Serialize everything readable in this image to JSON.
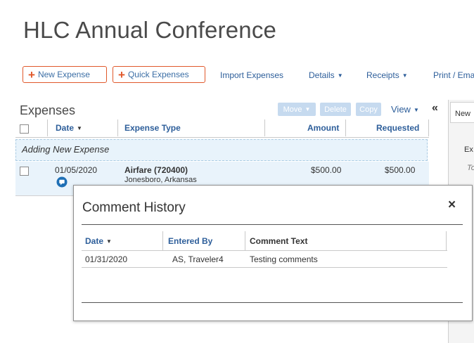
{
  "report": {
    "title": "HLC Annual Conference"
  },
  "toolbar": {
    "new_expense": "New Expense",
    "quick_expenses": "Quick Expenses",
    "import_expenses": "Import Expenses",
    "details": "Details",
    "receipts": "Receipts",
    "print_email": "Print / Ema"
  },
  "expenses": {
    "title": "Expenses",
    "actions": {
      "move": "Move",
      "delete": "Delete",
      "copy": "Copy",
      "view": "View"
    },
    "collapse_glyph": "«",
    "columns": {
      "date": "Date",
      "expense_type": "Expense Type",
      "amount": "Amount",
      "requested": "Requested"
    },
    "adding_label": "Adding New Expense",
    "rows": [
      {
        "date": "01/05/2020",
        "expense_type": "Airfare (720400)",
        "location": "Jonesboro, Arkansas",
        "amount": "$500.00",
        "requested": "$500.00"
      }
    ]
  },
  "right_panel": {
    "tab_label": "New",
    "frag_1": "Ex",
    "frag_2": "To"
  },
  "comment_modal": {
    "title": "Comment History",
    "close_glyph": "×",
    "columns": {
      "date": "Date",
      "entered_by": "Entered By",
      "comment_text": "Comment Text"
    },
    "rows": [
      {
        "date": "01/31/2020",
        "entered_by": "AS, Traveler4",
        "comment_text": "Testing comments"
      }
    ]
  },
  "colors": {
    "accent_orange": "#e0582b",
    "link_blue": "#2d5e9a",
    "row_highlight": "#e9f3fb"
  }
}
